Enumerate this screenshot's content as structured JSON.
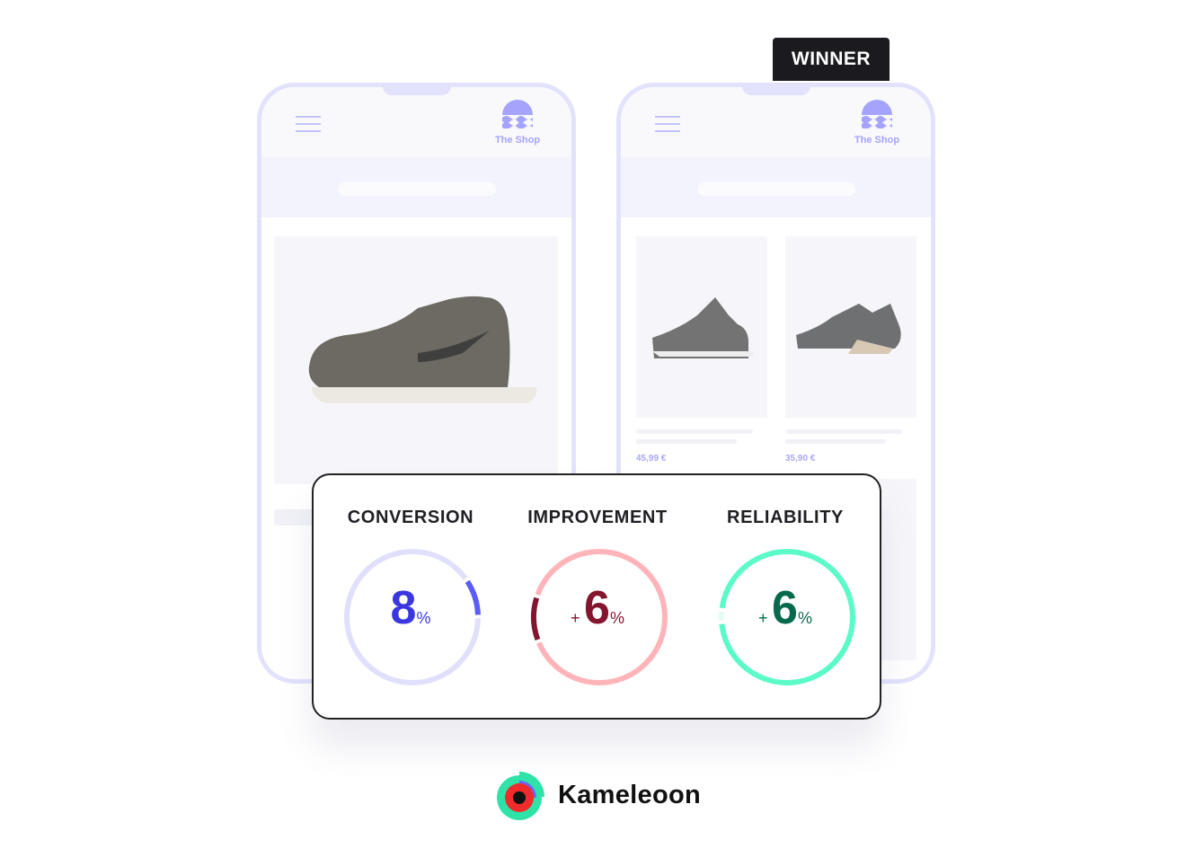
{
  "badge": {
    "label": "WINNER"
  },
  "shop": {
    "name": "The Shop"
  },
  "variant_b": {
    "prices": [
      "45,99 €",
      "35,90 €"
    ]
  },
  "stats": [
    {
      "label": "CONVERSION",
      "prefix": "",
      "value": "8",
      "unit": "%",
      "color": "#3a37e0",
      "track": "#e1e0fc",
      "arc": "#5b5cf6"
    },
    {
      "label": "IMPROVEMENT",
      "prefix": "+",
      "value": "6",
      "unit": "%",
      "color": "#84152f",
      "track": "#ffb4b9",
      "arc": "#84152f"
    },
    {
      "label": "RELIABILITY",
      "prefix": "+",
      "value": "6",
      "unit": "%",
      "color": "#076a4c",
      "track": "#5bfbc7",
      "arc": "#e3fdf4"
    }
  ],
  "brand": {
    "name": "Kameleoon"
  }
}
